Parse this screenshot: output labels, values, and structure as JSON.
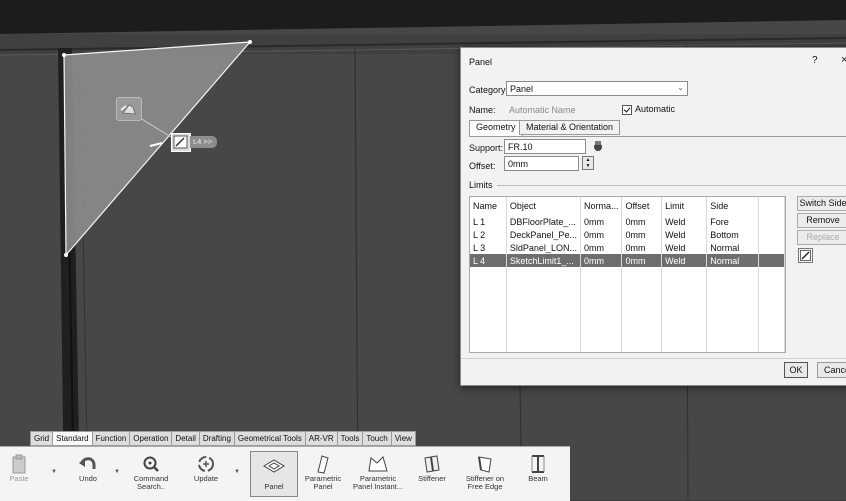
{
  "dialog": {
    "title": "Panel",
    "help_label": "?",
    "close_label": "×",
    "category_label": "Category:",
    "category_value": "Panel",
    "name_label": "Name:",
    "name_placeholder": "Automatic Name",
    "automatic_label": "Automatic",
    "tabs": [
      {
        "label": "Geometry",
        "active": true
      },
      {
        "label": "Material & Orientation",
        "active": false
      }
    ],
    "support_label": "Support:",
    "support_value": "FR.10",
    "offset_label": "Offset:",
    "offset_value": "0mm",
    "limits_label": "Limits",
    "table": {
      "headers": [
        "Name",
        "Object",
        "Norma...",
        "Offset",
        "Limit",
        "Side"
      ],
      "rows": [
        [
          "L 1",
          "DBFloorPlate_...",
          "0mm",
          "0mm",
          "Weld",
          "Fore"
        ],
        [
          "L 2",
          "DeckPanel_Pe...",
          "0mm",
          "0mm",
          "Weld",
          "Bottom"
        ],
        [
          "L 3",
          "SldPanel_LON...",
          "0mm",
          "0mm",
          "Weld",
          "Normal"
        ],
        [
          "L 4",
          "SketchLimit1_...",
          "0mm",
          "0mm",
          "Weld",
          "Normal"
        ]
      ],
      "selected_row": 3
    },
    "switch_side_label": "Switch Side",
    "remove_label": "Remove",
    "replace_label": "Replace",
    "ok_label": "OK",
    "cancel_label": "Cancel"
  },
  "viewport": {
    "limit_tag": "L4 >>"
  },
  "toolbar": {
    "tabs": [
      "Grid",
      "Standard",
      "Function",
      "Operation",
      "Detail",
      "Drafting",
      "Geometrical Tools",
      "AR-VR",
      "Tools",
      "Touch",
      "View"
    ],
    "active_tab": "Standard",
    "buttons": [
      {
        "label": "Paste",
        "icon": "paste-icon"
      },
      {
        "label": "Undo",
        "icon": "undo-icon"
      },
      {
        "label": "Command Search..",
        "icon": "search-icon"
      },
      {
        "label": "Update",
        "icon": "update-icon"
      },
      {
        "label": "Panel",
        "icon": "panel-icon"
      },
      {
        "label": "Parametric Panel",
        "icon": "parametric-panel-icon"
      },
      {
        "label": "Parametric Panel Instant...",
        "icon": "parametric-panel-instant-icon"
      },
      {
        "label": "Stiffener",
        "icon": "stiffener-icon"
      },
      {
        "label": "Stiffener on Free Edge",
        "icon": "stiffener-free-edge-icon"
      },
      {
        "label": "Beam",
        "icon": "beam-icon"
      }
    ]
  }
}
